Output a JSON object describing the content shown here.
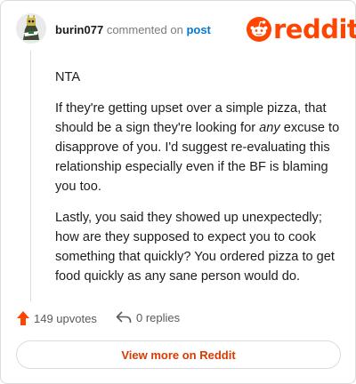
{
  "header": {
    "username": "burin077",
    "action": "commented on",
    "post_link": "post",
    "brand": "reddit"
  },
  "comment": {
    "paragraphs": [
      "NTA",
      "If they're getting upset over a simple pizza, that should be a sign they're looking for ",
      "any",
      " excuse to disapprove of you. I'd suggest re-evaluating this relationship especially even if the BF is blaming you too.",
      "Lastly, you said they showed up unexpectedly; how are they supposed to expect you to cook something that quickly? You ordered pizza to get food quickly as any sane person would do."
    ]
  },
  "footer": {
    "upvotes": "149 upvotes",
    "replies": "0 replies",
    "view_more": "View more on Reddit"
  },
  "colors": {
    "brand": "#ff4500",
    "link": "#0079d3",
    "cta": "#d93a00"
  },
  "icons": {
    "upvote": "upvote-arrow-icon",
    "reply": "reply-arrow-icon",
    "logo": "reddit-snoo-icon"
  }
}
